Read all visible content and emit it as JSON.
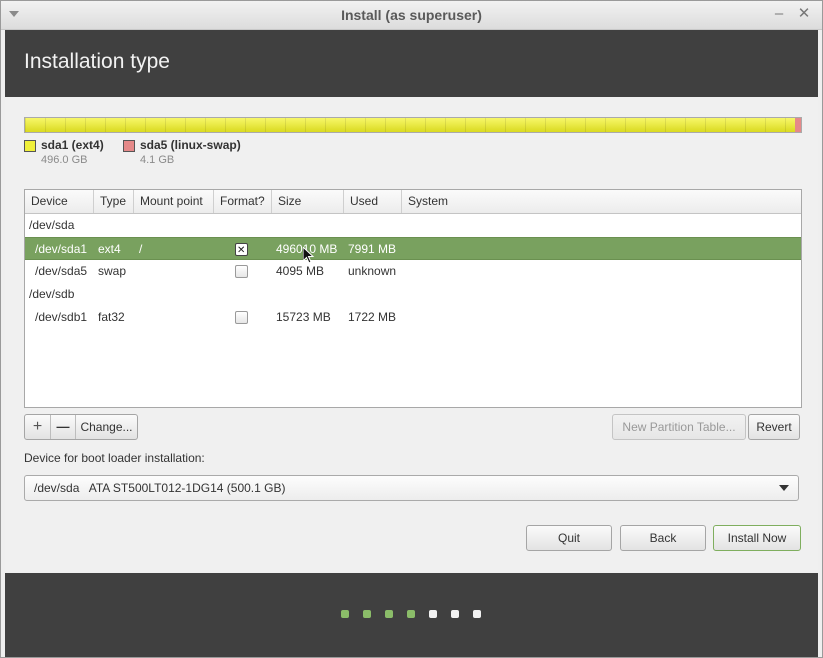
{
  "window": {
    "title": "Install (as superuser)",
    "minimize_glyph": "–",
    "close_glyph": "✕"
  },
  "header": {
    "title": "Installation type"
  },
  "partition_bar": {
    "legend": [
      {
        "name": "sda1 (ext4)",
        "size": "496.0 GB",
        "color": "#f0f03a"
      },
      {
        "name": "sda5 (linux-swap)",
        "size": "4.1 GB",
        "color": "#e58989"
      }
    ]
  },
  "table": {
    "columns": [
      "Device",
      "Type",
      "Mount point",
      "Format?",
      "Size",
      "Used",
      "System"
    ],
    "rows": [
      {
        "device": "/dev/sda",
        "kind": "disk"
      },
      {
        "device": "/dev/sda1",
        "type": "ext4",
        "mount": "/",
        "format": true,
        "size": "496010 MB",
        "used": "7991 MB",
        "system": "",
        "selected": true
      },
      {
        "device": "/dev/sda5",
        "type": "swap",
        "mount": "",
        "format": false,
        "size": "4095 MB",
        "used": "unknown",
        "system": ""
      },
      {
        "device": "/dev/sdb",
        "kind": "disk"
      },
      {
        "device": "/dev/sdb1",
        "type": "fat32",
        "mount": "",
        "format": false,
        "size": "15723 MB",
        "used": "1722 MB",
        "system": ""
      }
    ]
  },
  "toolbar": {
    "add_glyph": "+",
    "remove_glyph": "—",
    "change_label": "Change...",
    "new_partition_table_label": "New Partition Table...",
    "revert_label": "Revert"
  },
  "bootloader": {
    "label": "Device for boot loader installation:",
    "selected": "/dev/sda   ATA ST500LT012-1DG14 (500.1 GB)"
  },
  "actions": {
    "quit_label": "Quit",
    "back_label": "Back",
    "install_label": "Install Now"
  },
  "progress": {
    "completed_steps": 4,
    "total_steps": 7
  },
  "colors": {
    "accent": "#79a15f",
    "header_bg": "#404040"
  }
}
